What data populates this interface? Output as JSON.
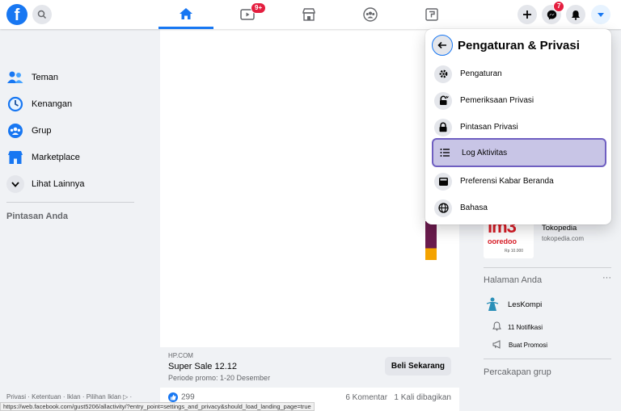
{
  "topbar": {
    "logo_letter": "f",
    "nav_badges": {
      "watch": "9+"
    },
    "messenger_badge": "7"
  },
  "sidebar": {
    "items": [
      {
        "label": "Teman",
        "icon": "friends-icon"
      },
      {
        "label": "Kenangan",
        "icon": "memories-icon"
      },
      {
        "label": "Grup",
        "icon": "groups-icon"
      },
      {
        "label": "Marketplace",
        "icon": "marketplace-icon"
      },
      {
        "label": "Lihat Lainnya",
        "icon": "chevron-down-icon"
      }
    ],
    "shortcuts_heading": "Pintasan Anda",
    "footer": "Privasi · Ketentuan · Iklan · Pilihan Iklan ▷ ·"
  },
  "feed": {
    "ad": {
      "source": "HP.COM",
      "title": "Super Sale 12.12",
      "subtitle": "Periode promo: 1-20 Desember",
      "cta": "Beli Sekarang"
    },
    "reactions": {
      "likes": "299",
      "comments": "6 Komentar",
      "shares": "1 Kali dibagikan"
    }
  },
  "statusbar": {
    "url": "https://web.facebook.com/gust5206/allactivity/?entry_point=settings_and_privacy&should_load_landing_page=true"
  },
  "right": {
    "sponsor": {
      "name": "Tokopedia",
      "url": "tokopedia.com",
      "image_text": "im3",
      "image_subtext": "ooredoo",
      "image_price": "Rp 10.000"
    },
    "pages_heading": "Halaman Anda",
    "pages_more": "···",
    "page_name": "LesKompi",
    "notifications": "11 Notifikasi",
    "promote": "Buat Promosi",
    "group_chats_heading": "Percakapan grup"
  },
  "panel": {
    "title": "Pengaturan & Privasi",
    "items": [
      {
        "label": "Pengaturan",
        "icon": "gear-icon"
      },
      {
        "label": "Pemeriksaan Privasi",
        "icon": "lock-check-icon"
      },
      {
        "label": "Pintasan Privasi",
        "icon": "lock-icon"
      },
      {
        "label": "Log Aktivitas",
        "icon": "list-icon"
      },
      {
        "label": "Preferensi Kabar Beranda",
        "icon": "feed-icon"
      },
      {
        "label": "Bahasa",
        "icon": "globe-icon"
      }
    ]
  },
  "colors": {
    "brand": "#1877f2",
    "badge": "#e41e3f",
    "highlight_bg": "#c8c5e6",
    "highlight_border": "#6f5fc1"
  }
}
